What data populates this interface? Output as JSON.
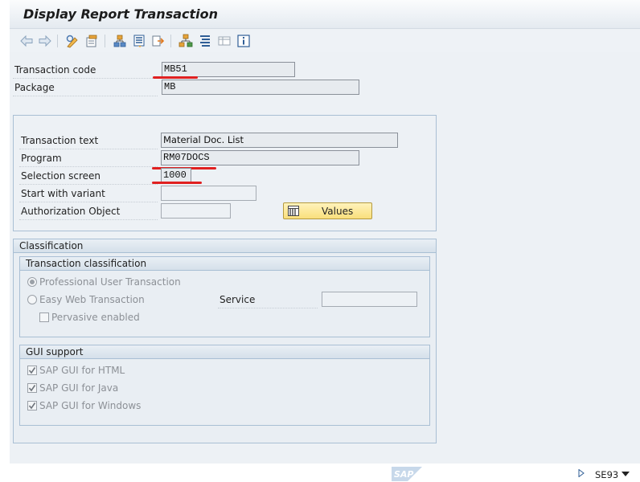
{
  "window": {
    "title": "Display Report Transaction"
  },
  "toolbar": {
    "icons": [
      "back-arrow-icon",
      "forward-arrow-icon",
      "display-change-icon",
      "other-object-icon",
      "hierarchy-icon",
      "list-icon",
      "navigate-icon",
      "object-list-icon",
      "navigation-tree-icon",
      "display-object-list-icon",
      "information-icon"
    ]
  },
  "header_fields": {
    "transaction_code": {
      "label": "Transaction code",
      "value": "MB51"
    },
    "package": {
      "label": "Package",
      "value": "MB"
    }
  },
  "details": {
    "transaction_text": {
      "label": "Transaction text",
      "value": "Material Doc. List"
    },
    "program": {
      "label": "Program",
      "value": "RM07DOCS"
    },
    "selection_screen": {
      "label": "Selection screen",
      "value": "1000"
    },
    "start_with_variant": {
      "label": "Start with variant",
      "value": ""
    },
    "authorization_object": {
      "label": "Authorization Object",
      "value": ""
    },
    "values_button": {
      "label": "Values"
    }
  },
  "classification": {
    "title": "Classification",
    "transaction_classification": {
      "title": "Transaction classification",
      "options": [
        {
          "label": "Professional User Transaction",
          "selected": true
        },
        {
          "label": "Easy Web Transaction",
          "selected": false
        }
      ],
      "service": {
        "label": "Service",
        "value": ""
      },
      "pervasive": {
        "label": "Pervasive enabled",
        "checked": false
      }
    },
    "gui_support": {
      "title": "GUI support",
      "options": [
        {
          "label": "SAP GUI for HTML",
          "checked": true
        },
        {
          "label": "SAP GUI for Java",
          "checked": true
        },
        {
          "label": "SAP GUI for Windows",
          "checked": true
        }
      ]
    }
  },
  "status_bar": {
    "logo": "SAP",
    "transaction": "SE93"
  },
  "colors": {
    "annotation_red": "#e02020",
    "values_button_fill": "#f9df7c",
    "background": "#edf1f5"
  }
}
